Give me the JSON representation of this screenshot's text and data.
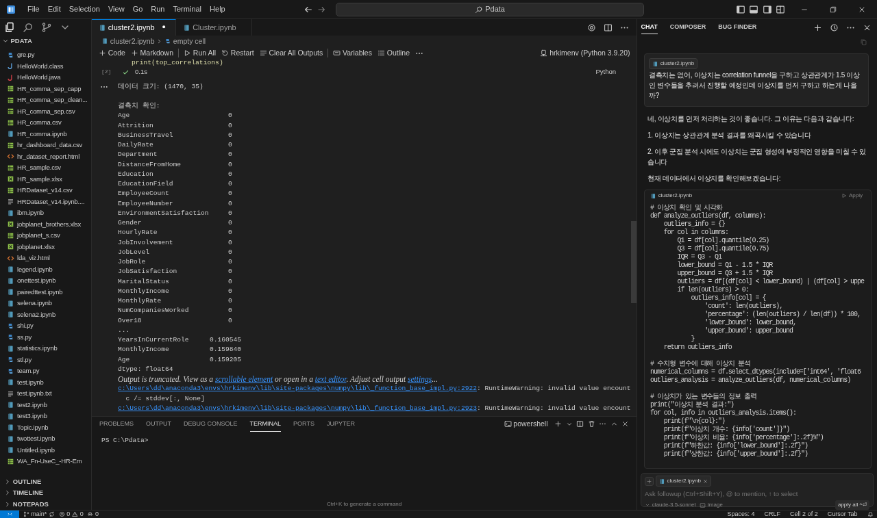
{
  "title_bar": {
    "menus": [
      "File",
      "Edit",
      "Selection",
      "View",
      "Go",
      "Run",
      "Terminal",
      "Help"
    ],
    "search": "Pdata"
  },
  "activity": [
    {
      "selected": true
    },
    {
      "selected": false
    },
    {
      "selected": false
    },
    {
      "selected": false
    }
  ],
  "explorer": {
    "title": "PDATA",
    "files": [
      {
        "name": "gre.py",
        "kind": "python"
      },
      {
        "name": "HelloWorld.class",
        "kind": "class"
      },
      {
        "name": "HelloWorld.java",
        "kind": "java"
      },
      {
        "name": "HR_comma_sep_capp",
        "kind": "csv"
      },
      {
        "name": "HR_comma_sep_clean...",
        "kind": "csv"
      },
      {
        "name": "HR_comma_sep.csv",
        "kind": "csv"
      },
      {
        "name": "HR_comma.csv",
        "kind": "csv"
      },
      {
        "name": "HR_comma.ipynb",
        "kind": "notebook"
      },
      {
        "name": "hr_dashboard_data.csv",
        "kind": "csv"
      },
      {
        "name": "hr_dataset_report.html",
        "kind": "html"
      },
      {
        "name": "HR_sample.csv",
        "kind": "csv"
      },
      {
        "name": "HR_sample.xlsx",
        "kind": "excel"
      },
      {
        "name": "HRDataset_v14.csv",
        "kind": "csv"
      },
      {
        "name": "HRDataset_v14.ipynb....",
        "kind": "text"
      },
      {
        "name": "ibm.ipynb",
        "kind": "notebook"
      },
      {
        "name": "jobplanet_brothers.xlsx",
        "kind": "excel"
      },
      {
        "name": "jobplanet_s.csv",
        "kind": "csv"
      },
      {
        "name": "jobplanet.xlsx",
        "kind": "excel"
      },
      {
        "name": "lda_viz.html",
        "kind": "html"
      },
      {
        "name": "legend.ipynb",
        "kind": "notebook"
      },
      {
        "name": "onettest.ipynb",
        "kind": "notebook"
      },
      {
        "name": "pairedttest.ipynb",
        "kind": "notebook"
      },
      {
        "name": "selena.ipynb",
        "kind": "notebook"
      },
      {
        "name": "selena2.ipynb",
        "kind": "notebook"
      },
      {
        "name": "shi.py",
        "kind": "python"
      },
      {
        "name": "ss.py",
        "kind": "python"
      },
      {
        "name": "statistics.ipynb",
        "kind": "notebook"
      },
      {
        "name": "stl.py",
        "kind": "python"
      },
      {
        "name": "team.py",
        "kind": "python"
      },
      {
        "name": "test.ipynb",
        "kind": "notebook"
      },
      {
        "name": "test.ipynb.txt",
        "kind": "text"
      },
      {
        "name": "test2.ipynb",
        "kind": "notebook"
      },
      {
        "name": "test3.ipynb",
        "kind": "notebook"
      },
      {
        "name": "Topic.ipynb",
        "kind": "notebook"
      },
      {
        "name": "twottest.ipynb",
        "kind": "notebook"
      },
      {
        "name": "Untitled.ipynb",
        "kind": "notebook"
      },
      {
        "name": "WA_Fn-UseC_-HR-Em",
        "kind": "csv"
      }
    ],
    "sections": [
      {
        "label": "OUTLINE",
        "expanded": false
      },
      {
        "label": "TIMELINE",
        "expanded": false
      },
      {
        "label": "NOTEPADS",
        "expanded": false
      }
    ]
  },
  "editor": {
    "tabs": [
      {
        "label": "cluster2.ipynb",
        "selected": true,
        "modified": true
      },
      {
        "label": "Cluster.ipynb",
        "selected": false,
        "modified": false
      }
    ],
    "breadcrumb": [
      "cluster2.ipynb",
      "empty cell"
    ],
    "toolbar": [
      "Code",
      "Markdown",
      "Run All",
      "Restart",
      "Clear All Outputs",
      "Variables",
      "Outline"
    ],
    "kernel": "hrkimenv (Python 3.9.20)",
    "cell": {
      "code_line": "print(top_correlations)",
      "execution_count": "[2]",
      "duration": "0.1s",
      "language": "Python"
    },
    "output": {
      "shape_line": "데이터 크기: (1470, 35)",
      "missing_title": "결측치 확인:",
      "missing": [
        [
          "Age",
          "0"
        ],
        [
          "Attrition",
          "0"
        ],
        [
          "BusinessTravel",
          "0"
        ],
        [
          "DailyRate",
          "0"
        ],
        [
          "Department",
          "0"
        ],
        [
          "DistanceFromHome",
          "0"
        ],
        [
          "Education",
          "0"
        ],
        [
          "EducationField",
          "0"
        ],
        [
          "EmployeeCount",
          "0"
        ],
        [
          "EmployeeNumber",
          "0"
        ],
        [
          "EnvironmentSatisfaction",
          "0"
        ],
        [
          "Gender",
          "0"
        ],
        [
          "HourlyRate",
          "0"
        ],
        [
          "JobInvolvement",
          "0"
        ],
        [
          "JobLevel",
          "0"
        ],
        [
          "JobRole",
          "0"
        ],
        [
          "JobSatisfaction",
          "0"
        ],
        [
          "MaritalStatus",
          "0"
        ],
        [
          "MonthlyIncome",
          "0"
        ],
        [
          "MonthlyRate",
          "0"
        ],
        [
          "NumCompaniesWorked",
          "0"
        ],
        [
          "Over18",
          "0"
        ]
      ],
      "ellipsis": "...",
      "correlations": [
        [
          "YearsInCurrentRole",
          "0.160545"
        ],
        [
          "MonthlyIncome",
          "0.159840"
        ],
        [
          "Age",
          "0.159205"
        ]
      ],
      "dtype": "dtype: float64",
      "truncation": [
        {
          "text": "Output is truncated. View as a ",
          "link": false
        },
        {
          "text": "scrollable element",
          "link": true
        },
        {
          "text": " or open in a ",
          "link": false
        },
        {
          "text": "text editor",
          "link": true
        },
        {
          "text": ". Adjust cell output ",
          "link": false
        },
        {
          "text": "settings",
          "link": true
        },
        {
          "text": "...",
          "link": false
        }
      ],
      "warnings": [
        {
          "path": "c:\\Users\\dd\\anaconda3\\envs\\hrkimenv\\lib\\site-packages\\numpy\\lib\\_function_base_impl.py:2922",
          "message": ": RuntimeWarning: invalid value encount",
          "source": "  c /= stddev[:, None]"
        },
        {
          "path": "c:\\Users\\dd\\anaconda3\\envs\\hrkimenv\\lib\\site-packages\\numpy\\lib\\_function_base_impl.py:2923",
          "message": ": RuntimeWarning: invalid value encount"
        }
      ]
    }
  },
  "panel": {
    "tabs": [
      {
        "label": "PROBLEMS",
        "selected": false
      },
      {
        "label": "OUTPUT",
        "selected": false
      },
      {
        "label": "DEBUG CONSOLE",
        "selected": false
      },
      {
        "label": "TERMINAL",
        "selected": true
      },
      {
        "label": "PORTS",
        "selected": false
      },
      {
        "label": "JUPYTER",
        "selected": false
      }
    ],
    "shell": "powershell",
    "prompt": "PS C:\\Pdata>",
    "hint": "Ctrl+K to generate a command"
  },
  "chat": {
    "tabs": [
      {
        "label": "CHAT",
        "selected": true
      },
      {
        "label": "COMPOSER",
        "selected": false
      },
      {
        "label": "BUG FINDER",
        "selected": false
      }
    ],
    "user_message": {
      "file": "cluster2.ipynb",
      "text": "결측치는 없어, 이상치는 correlation funnel을 구하고 상관관계가 1.5 이상인 변수들을 추려서 진행할 예정인데 이상치를 먼저 구하고 하는게 나을까?"
    },
    "response": [
      "네, 이상치를 먼저 처리하는 것이 좋습니다. 그 이유는 다음과 같습니다:",
      "1. 이상치는 상관관계 분석 결과를 왜곡시킬 수 있습니다",
      "2. 이후 군집 분석 시에도 이상치는 군집 형성에 부정적인 영향을 미칠 수 있습니다",
      "현재 데이터에서 이상치를 확인해보겠습니다:"
    ],
    "code_block": {
      "file": "cluster2.ipynb",
      "action": "Apply",
      "blocks": [
        [
          "# 이상치 확인 및 시각화",
          "def analyze_outliers(df, columns):",
          "    outliers_info = {}",
          "    for col in columns:",
          "        Q1 = df[col].quantile(0.25)",
          "        Q3 = df[col].quantile(0.75)",
          "        IQR = Q3 - Q1",
          "        lower_bound = Q1 - 1.5 * IQR",
          "        upper_bound = Q3 + 1.5 * IQR",
          "        outliers = df[(df[col] < lower_bound) | (df[col] > uppe",
          "        if len(outliers) > 0:",
          "            outliers_info[col] = {",
          "                'count': len(outliers),",
          "                'percentage': (len(outliers) / len(df)) * 100,",
          "                'lower_bound': lower_bound,",
          "                'upper_bound': upper_bound",
          "            }",
          "    return outliers_info"
        ],
        [
          "# 수치형 변수에 대해 이상치 분석",
          "numerical_columns = df.select_dtypes(include=['int64', 'float6",
          "outliers_analysis = analyze_outliers(df, numerical_columns)"
        ],
        [
          "# 이상치가 있는 변수들의 정보 출력",
          "print(\"이상치 분석 결과:\")",
          "for col, info in outliers_analysis.items():",
          "    print(f\"\\n{col}:\")",
          "    print(f\"이상치 개수: {info['count']}\")",
          "    print(f\"이상치 비율: {info['percentage']:.2f}%\")",
          "    print(f\"하한값: {info['lower_bound']:.2f}\")",
          "    print(f\"상한값: {info['upper_bound']:.2f}\")"
        ]
      ]
    },
    "input": {
      "chip": "cluster2.ipynb",
      "placeholder": "Ask followup (Ctrl+Shift+Y), @ to mention, ↑ to select",
      "model": "claude-3.5-sonnet",
      "image_label": "image",
      "apply": "apply all",
      "shortcut": "^⏎"
    }
  },
  "status_bar": {
    "branch": "main*",
    "errors": "0",
    "warnings": "0",
    "ports": "0",
    "right": [
      "Spaces: 4",
      "CRLF",
      "Cell 2 of 2",
      "Cursor Tab"
    ]
  }
}
